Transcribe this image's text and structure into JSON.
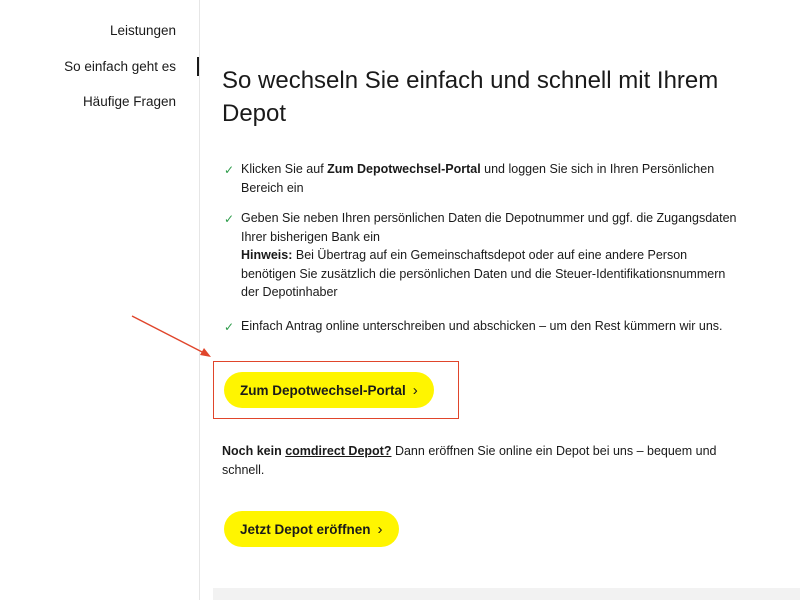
{
  "sidebar": {
    "items": [
      {
        "label": "Leistungen"
      },
      {
        "label": "So einfach geht es",
        "active": true
      },
      {
        "label": "Häufige Fragen"
      }
    ]
  },
  "main": {
    "title": "So wechseln Sie einfach und schnell mit Ihrem Depot",
    "steps": [
      {
        "pre": "Klicken Sie auf ",
        "bold": "Zum Depotwechsel-Portal",
        "post": " und loggen Sie sich in Ihren Persönlichen Bereich ein"
      },
      {
        "text": "Geben Sie neben Ihren persönlichen Daten die Depotnummer und ggf. die Zugangsdaten Ihrer bisherigen Bank ein",
        "hint_label": "Hinweis:",
        "hint_text": " Bei Übertrag auf ein Gemeinschaftsdepot oder auf eine andere Person benötigen Sie zusätzlich die persönlichen Daten und die Steuer-Identifikationsnummern der Depotinhaber"
      },
      {
        "text": "Einfach Antrag online unterschreiben und abschicken – um den Rest kümmern wir uns."
      }
    ],
    "portal_button": "Zum Depotwechsel-Portal",
    "note": {
      "pre": "Noch kein ",
      "link": "comdirect Depot?",
      "post": " Dann eröffnen Sie online ein Depot bei uns – bequem und schnell."
    },
    "open_button": "Jetzt Depot eröffnen"
  },
  "icons": {
    "check": "check-icon",
    "chevron": "chevron-right-icon"
  },
  "colors": {
    "accent_yellow": "#fff500",
    "check_green": "#2d9c4a",
    "annotation_red": "#e0452b"
  }
}
